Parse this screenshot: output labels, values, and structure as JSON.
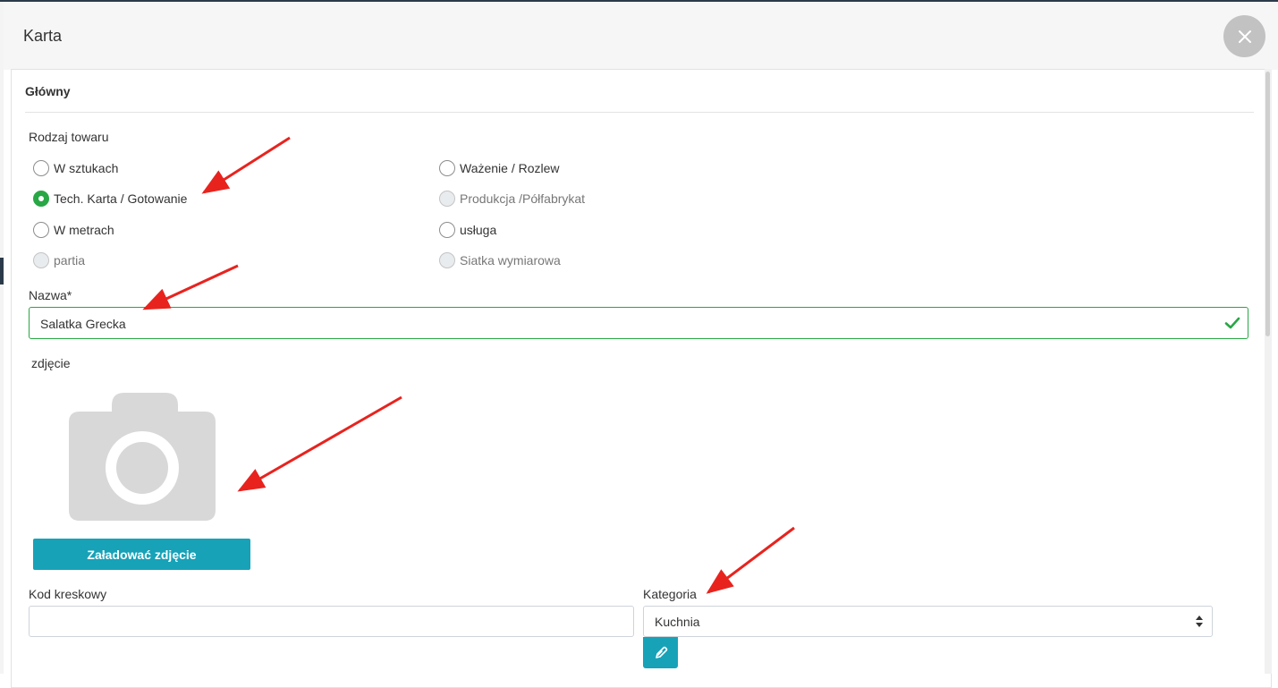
{
  "modal": {
    "title": "Karta"
  },
  "panel": {
    "tab_label": "Główny"
  },
  "product_type": {
    "label": "Rodzaj towaru",
    "options": [
      {
        "label": "W sztukach",
        "checked": false,
        "disabled": false
      },
      {
        "label": "Tech. Karta / Gotowanie",
        "checked": true,
        "disabled": false
      },
      {
        "label": "W metrach",
        "checked": false,
        "disabled": false
      },
      {
        "label": "partia",
        "checked": false,
        "disabled": true
      },
      {
        "label": "Ważenie / Rozlew",
        "checked": false,
        "disabled": false
      },
      {
        "label": "Produkcja /Półfabrykat",
        "checked": false,
        "disabled": true
      },
      {
        "label": "usługa",
        "checked": false,
        "disabled": false
      },
      {
        "label": "Siatka wymiarowa",
        "checked": false,
        "disabled": true
      }
    ]
  },
  "name_field": {
    "label": "Nazwa*",
    "value": "Salatka Grecka",
    "valid": true
  },
  "photo": {
    "label": "zdjęcie",
    "icon": "camera-placeholder-icon",
    "upload_label": "Załadować zdjęcie"
  },
  "barcode": {
    "label": "Kod kreskowy",
    "value": ""
  },
  "category": {
    "label": "Kategoria",
    "selected": "Kuchnia",
    "edit_icon": "pencil-icon"
  },
  "colors": {
    "accent": "#17a2b8",
    "success": "#28a745",
    "annotation_arrow": "#e8231e",
    "placeholder_gray": "#d8d8d8"
  }
}
